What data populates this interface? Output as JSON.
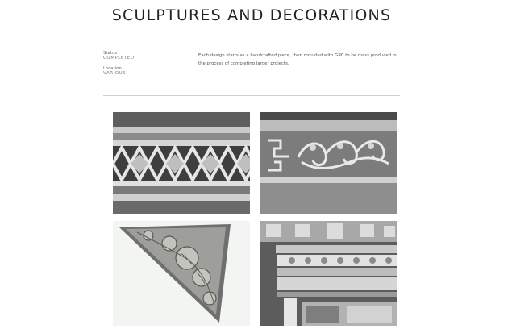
{
  "page": {
    "title": "SCULPTURES AND DECORATIONS"
  },
  "meta": {
    "status_label": "Status",
    "status_value": "COMPLETED",
    "location_label": "Location",
    "location_value": "VARIOUS"
  },
  "description": "Each design starts as a handcrafted piece, then moulded with GRC to be mass produced in the process of completing larger projects."
}
